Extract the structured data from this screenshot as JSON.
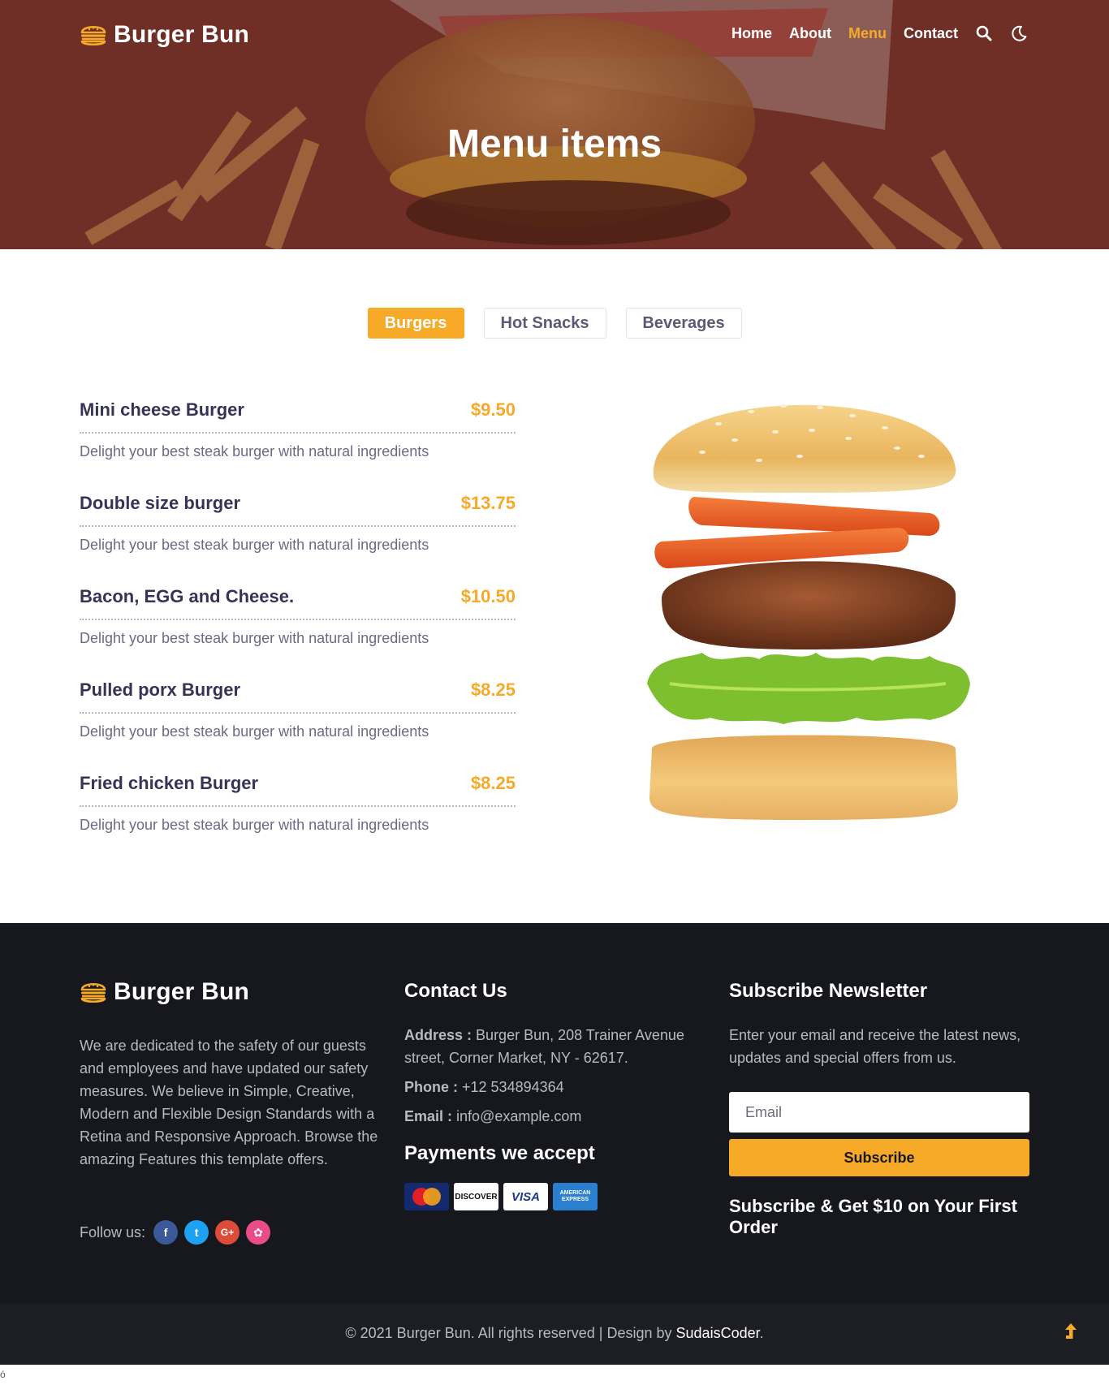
{
  "brand": {
    "name": "Burger Bun",
    "icon": "burger-icon"
  },
  "nav": {
    "items": [
      {
        "label": "Home",
        "active": false
      },
      {
        "label": "About",
        "active": false
      },
      {
        "label": "Menu",
        "active": true
      },
      {
        "label": "Contact",
        "active": false
      }
    ],
    "search_icon": "search-icon",
    "theme_icon": "moon-icon"
  },
  "hero": {
    "title": "Menu items"
  },
  "tabs": [
    {
      "label": "Burgers",
      "active": true
    },
    {
      "label": "Hot Snacks",
      "active": false
    },
    {
      "label": "Beverages",
      "active": false
    }
  ],
  "menu": {
    "items": [
      {
        "name": "Mini cheese Burger",
        "price": "$9.50",
        "desc": "Delight your best steak burger with natural ingredients"
      },
      {
        "name": "Double size burger",
        "price": "$13.75",
        "desc": "Delight your best steak burger with natural ingredients"
      },
      {
        "name": "Bacon, EGG and Cheese.",
        "price": "$10.50",
        "desc": "Delight your best steak burger with natural ingredients"
      },
      {
        "name": "Pulled porx Burger",
        "price": "$8.25",
        "desc": "Delight your best steak burger with natural ingredients"
      },
      {
        "name": "Fried chicken Burger",
        "price": "$8.25",
        "desc": "Delight your best steak burger with natural ingredients"
      }
    ]
  },
  "footer": {
    "about": "We are dedicated to the safety of our guests and employees and have updated our safety measures. We believe in Simple, Creative, Modern and Flexible Design Standards with a Retina and Responsive Approach. Browse the amazing Features this template offers.",
    "follow_label": "Follow us:",
    "socials": [
      {
        "icon": "facebook-icon",
        "glyph": "f",
        "color": "#3b5998"
      },
      {
        "icon": "twitter-icon",
        "glyph": "t",
        "color": "#1da1f2"
      },
      {
        "icon": "google-plus-icon",
        "glyph": "G+",
        "color": "#dd4b39"
      },
      {
        "icon": "dribbble-icon",
        "glyph": "✿",
        "color": "#ea4c89"
      }
    ],
    "contact": {
      "heading": "Contact Us",
      "address_label": "Address :",
      "address": "Burger Bun, 208 Trainer Avenue street, Corner Market, NY - 62617.",
      "phone_label": "Phone :",
      "phone": "+12 534894364",
      "email_label": "Email :",
      "email": "info@example.com"
    },
    "payments": {
      "heading": "Payments we accept",
      "cards": [
        "MasterCard",
        "DISCOVER",
        "VISA",
        "AMERICAN EXPRESS"
      ]
    },
    "newsletter": {
      "heading": "Subscribe Newsletter",
      "text": "Enter your email and receive the latest news, updates and special offers from us.",
      "placeholder": "Email",
      "button": "Subscribe",
      "offer": "Subscribe & Get $10 on Your First Order"
    },
    "copyright": "© 2021 Burger Bun. All rights reserved | Design by ",
    "designer": "SudaisCoder",
    "copyright_end": ".",
    "to_top_icon": "arrow-up-icon"
  },
  "stray_char": "ó",
  "colors": {
    "accent": "#f7a928",
    "footer_bg": "#17181d",
    "heading": "#363456"
  }
}
